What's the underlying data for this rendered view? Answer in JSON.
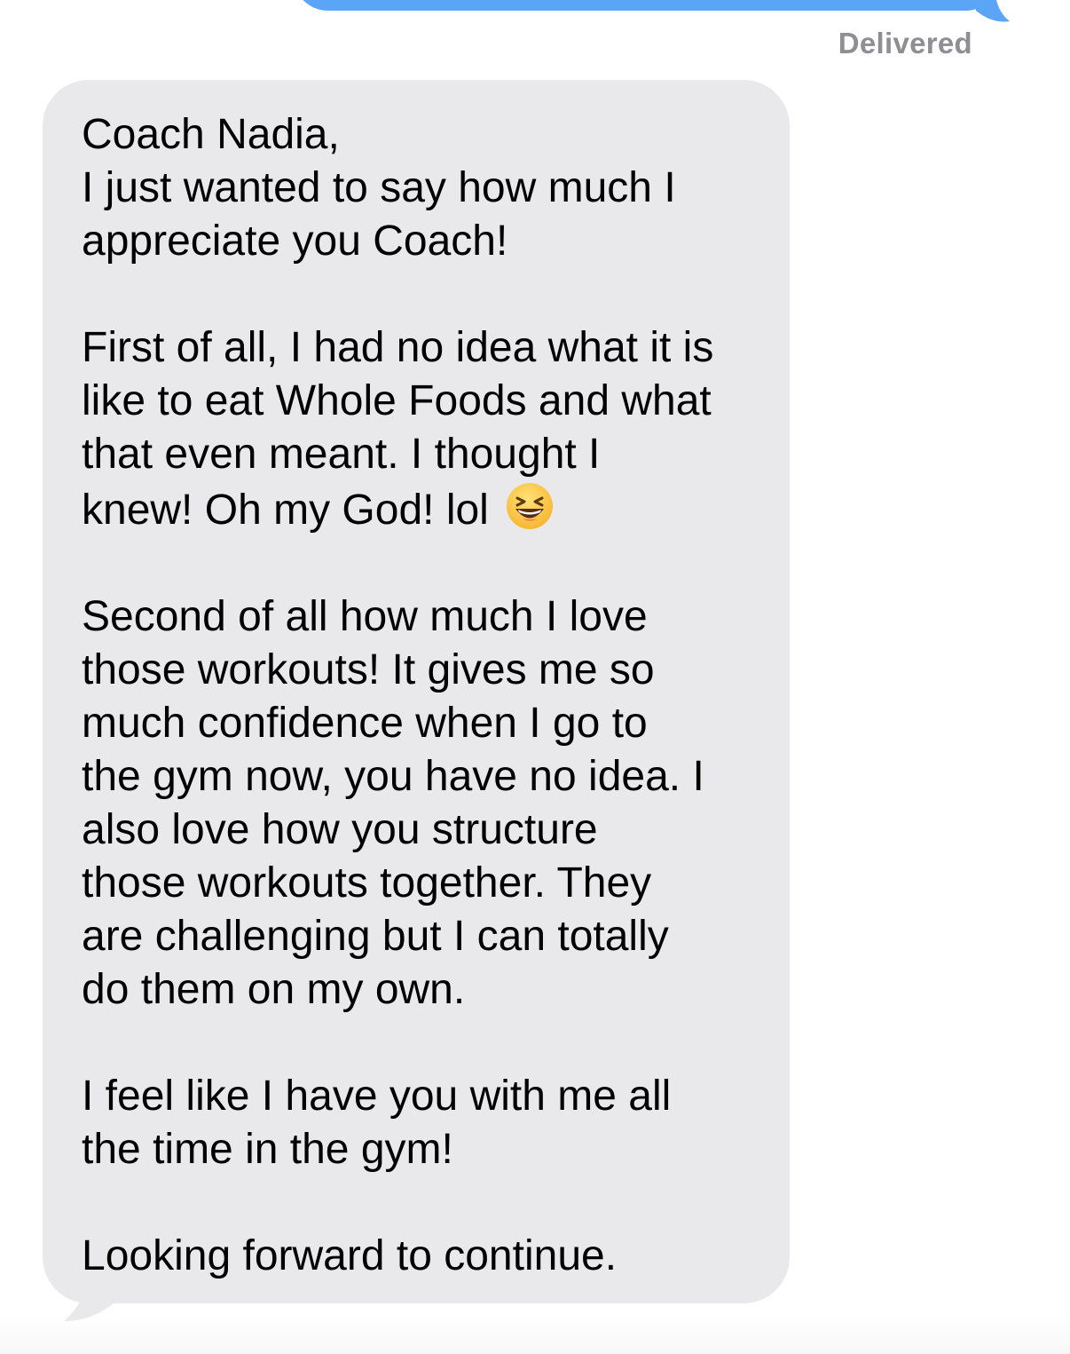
{
  "conversation": {
    "status": "Delivered",
    "message": {
      "paragraphs": [
        "Coach Nadia,\nI just wanted to say how much I\nappreciate you Coach!",
        "First of all, I had no idea what it is\nlike to eat Whole Foods and what\nthat even meant. I thought I\nknew! Oh my God! lol",
        "Second of all how much I love\nthose workouts! It gives me so\nmuch confidence when I go to\nthe gym now, you have no idea. I\nalso love how you structure\nthose workouts together. They\nare challenging but I can totally\ndo them on my own.",
        "I feel like I have you with me all\nthe time in the gym!",
        "Looking forward to continue."
      ],
      "emoji": "laughing-face-icon"
    }
  },
  "colors": {
    "sent_bubble": "#5aa5f5",
    "received_bubble": "#e9e9eb",
    "status_text": "#8e8e93"
  }
}
